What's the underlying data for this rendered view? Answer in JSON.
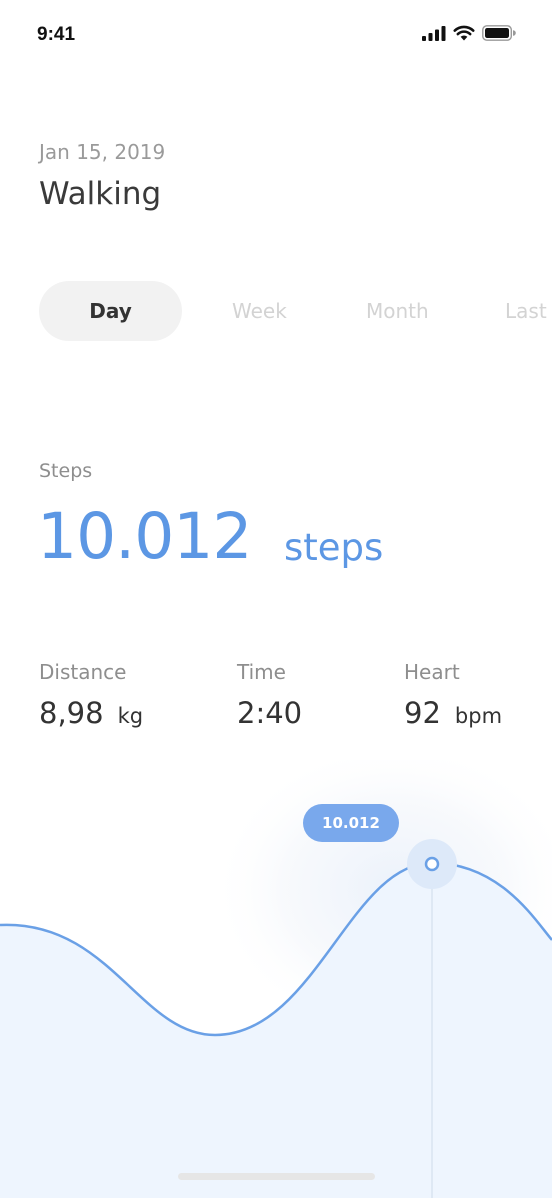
{
  "status_bar": {
    "time": "9:41",
    "icons": [
      "signal-icon",
      "wifi-icon",
      "battery-icon"
    ]
  },
  "header": {
    "date": "Jan 15, 2019",
    "title": "Walking"
  },
  "tabs": [
    {
      "label": "Day",
      "active": true
    },
    {
      "label": "Week",
      "active": false
    },
    {
      "label": "Month",
      "active": false
    },
    {
      "label": "Last",
      "active": false
    }
  ],
  "steps": {
    "label": "Steps",
    "value": "10.012",
    "unit": "steps"
  },
  "metrics": {
    "distance": {
      "label": "Distance",
      "value": "8,98",
      "unit": "kg"
    },
    "time": {
      "label": "Time",
      "value": "2:40"
    },
    "heart": {
      "label": "Heart",
      "value": "92",
      "unit": "bpm"
    }
  },
  "chart": {
    "tooltip_value": "10.012"
  },
  "colors": {
    "accent": "#5c97e4",
    "tooltip_bg": "#79a8ec",
    "chart_fill": "#eef5fe",
    "tab_active_bg": "#f2f2f2"
  }
}
